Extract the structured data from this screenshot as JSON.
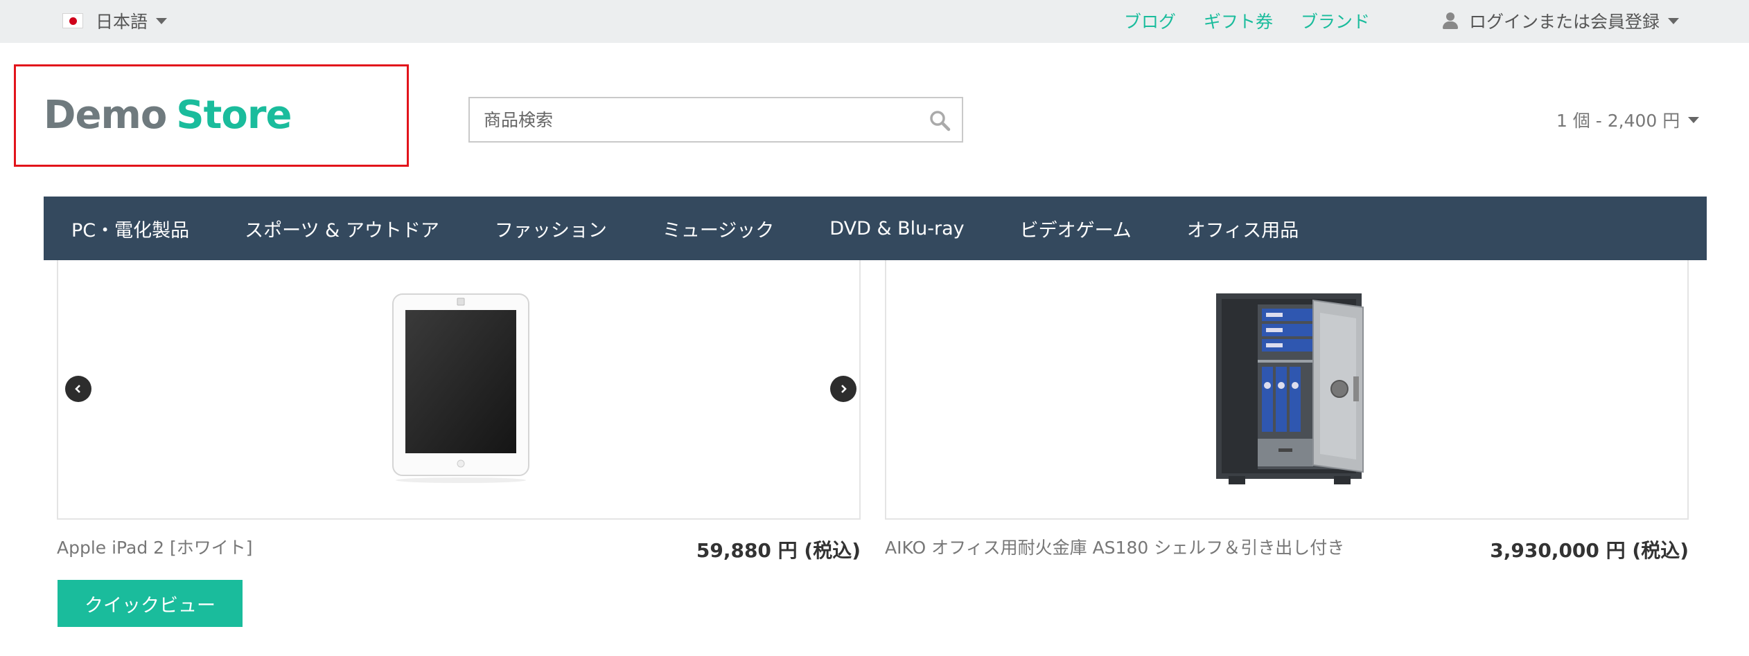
{
  "topbar": {
    "language": "日本語",
    "links": [
      "ブログ",
      "ギフト券",
      "ブランド"
    ],
    "account": "ログインまたは会員登録"
  },
  "logo": {
    "part1": "Demo",
    "part2": "Store"
  },
  "search": {
    "placeholder": "商品検索"
  },
  "cart": {
    "label": "1 個 - 2,400 円"
  },
  "nav": [
    "PC・電化製品",
    "スポーツ & アウトドア",
    "ファッション",
    "ミュージック",
    "DVD & Blu-ray",
    "ビデオゲーム",
    "オフィス用品"
  ],
  "products": [
    {
      "name": "Apple iPad 2 [ホワイト]",
      "price": "59,880 円 (税込)",
      "image": "tablet-image"
    },
    {
      "name": "AIKO オフィス用耐火金庫 AS180 シェルフ＆引き出し付き",
      "price": "3,930,000 円 (税込)",
      "image": "safe-image"
    }
  ],
  "quickview_label": "クイックビュー",
  "colors": {
    "accent": "#1abc9c",
    "nav_bg": "#34495e",
    "logo_gray": "#6f7a7e",
    "highlight_border": "#e2141b"
  }
}
